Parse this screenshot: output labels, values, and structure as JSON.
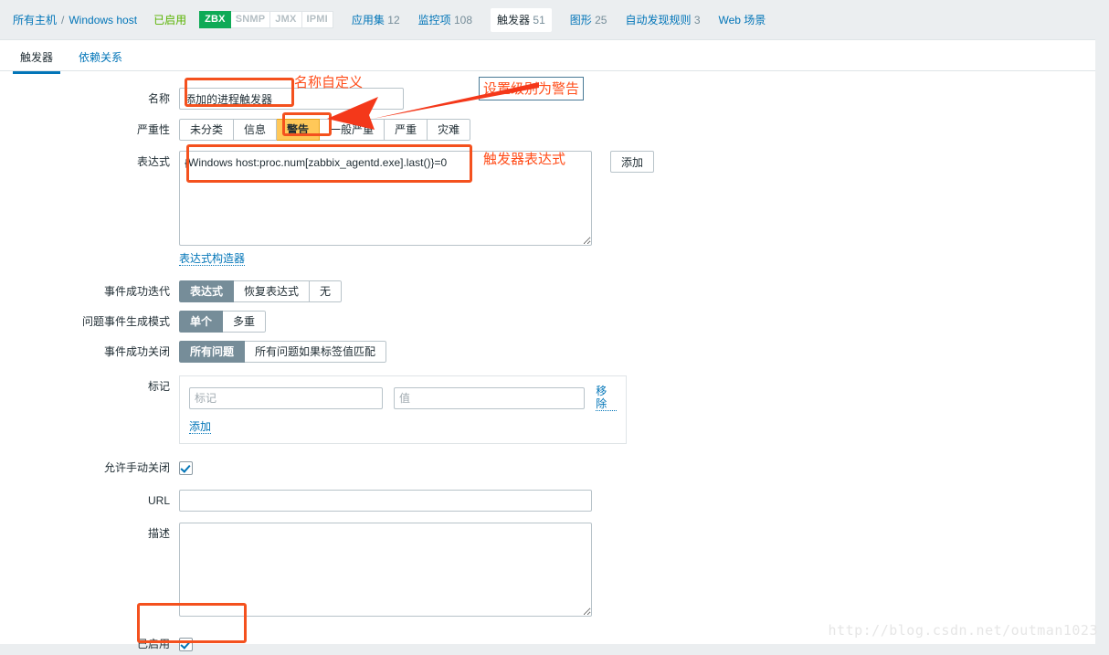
{
  "topbar": {
    "all_hosts": "所有主机",
    "separator": "/",
    "host_name": "Windows host",
    "status": "已启用",
    "interfaces": [
      {
        "label": "ZBX",
        "enabled": true
      },
      {
        "label": "SNMP",
        "enabled": false
      },
      {
        "label": "JMX",
        "enabled": false
      },
      {
        "label": "IPMI",
        "enabled": false
      }
    ],
    "nav": [
      {
        "label": "应用集",
        "count": "12",
        "selected": false
      },
      {
        "label": "监控项",
        "count": "108",
        "selected": false
      },
      {
        "label": "触发器",
        "count": "51",
        "selected": true
      },
      {
        "label": "图形",
        "count": "25",
        "selected": false
      },
      {
        "label": "自动发现规则",
        "count": "3",
        "selected": false
      },
      {
        "label": "Web 场景",
        "count": "",
        "selected": false
      }
    ]
  },
  "tabs": [
    {
      "label": "触发器",
      "active": true
    },
    {
      "label": "依赖关系",
      "active": false
    }
  ],
  "form": {
    "name_label": "名称",
    "name_value": "添加的进程触发器",
    "severity_label": "严重性",
    "severity_options": [
      "未分类",
      "信息",
      "警告",
      "一般严重",
      "严重",
      "灾难"
    ],
    "severity_selected": "警告",
    "expression_label": "表达式",
    "expression_value": "{Windows host:proc.num[zabbix_agentd.exe].last()}=0",
    "expression_add_button": "添加",
    "expression_constructor_link": "表达式构造器",
    "ok_event_label": "事件成功迭代",
    "ok_event_options": [
      "表达式",
      "恢复表达式",
      "无"
    ],
    "ok_event_selected": "表达式",
    "problem_event_label": "问题事件生成模式",
    "problem_event_options": [
      "单个",
      "多重"
    ],
    "problem_event_selected": "单个",
    "close_event_label": "事件成功关闭",
    "close_event_options": [
      "所有问题",
      "所有问题如果标签值匹配"
    ],
    "close_event_selected": "所有问题",
    "tags_label": "标记",
    "tag_name_placeholder": "标记",
    "tag_value_placeholder": "值",
    "tag_remove_link": "移除",
    "tag_add_link": "添加",
    "manual_close_label": "允许手动关闭",
    "manual_close_checked": true,
    "url_label": "URL",
    "url_value": "",
    "description_label": "描述",
    "description_value": "",
    "enabled_label": "已启用",
    "enabled_checked": true
  },
  "annotations": {
    "name_custom": "名称自定义",
    "set_severity_warning": "设置级别为警告",
    "trigger_expression": "触发器表达式"
  },
  "watermark": "http://blog.csdn.net/outman1023",
  "colors": {
    "page_bg": "#ebeef0",
    "link": "#0275b8",
    "status_green": "#59b300",
    "zbx_badge": "#0eaa56",
    "selected_segment": "#768d99",
    "warning": "#ffc859",
    "annotation": "#ff4d1a"
  }
}
